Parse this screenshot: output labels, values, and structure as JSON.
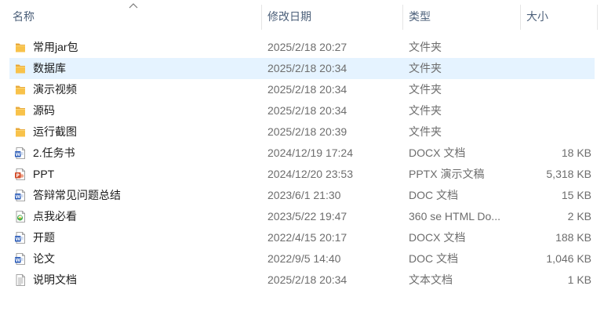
{
  "columns": {
    "name": "名称",
    "date": "修改日期",
    "type": "类型",
    "size": "大小"
  },
  "rows": [
    {
      "name": "常用jar包",
      "date": "2025/2/18 20:27",
      "type": "文件夹",
      "size": "",
      "icon": "folder-icon"
    },
    {
      "name": "数据库",
      "date": "2025/2/18 20:34",
      "type": "文件夹",
      "size": "",
      "icon": "folder-icon",
      "selected": true
    },
    {
      "name": "演示视频",
      "date": "2025/2/18 20:34",
      "type": "文件夹",
      "size": "",
      "icon": "folder-icon"
    },
    {
      "name": "源码",
      "date": "2025/2/18 20:34",
      "type": "文件夹",
      "size": "",
      "icon": "folder-icon"
    },
    {
      "name": "运行截图",
      "date": "2025/2/18 20:39",
      "type": "文件夹",
      "size": "",
      "icon": "folder-icon"
    },
    {
      "name": "2.任务书",
      "date": "2024/12/19 17:24",
      "type": "DOCX 文档",
      "size": "18 KB",
      "icon": "word-doc-icon"
    },
    {
      "name": "PPT",
      "date": "2024/12/20 23:53",
      "type": "PPTX 演示文稿",
      "size": "5,318 KB",
      "icon": "powerpoint-icon"
    },
    {
      "name": "答辩常见问题总结",
      "date": "2023/6/1 21:30",
      "type": "DOC 文档",
      "size": "15 KB",
      "icon": "word-doc-icon"
    },
    {
      "name": "点我必看",
      "date": "2023/5/22 19:47",
      "type": "360 se HTML Do...",
      "size": "2 KB",
      "icon": "html-file-icon"
    },
    {
      "name": "开题",
      "date": "2022/4/15 20:17",
      "type": "DOCX 文档",
      "size": "188 KB",
      "icon": "word-doc-icon"
    },
    {
      "name": "论文",
      "date": "2022/9/5 14:40",
      "type": "DOC 文档",
      "size": "1,046 KB",
      "icon": "word-doc-icon"
    },
    {
      "name": "说明文档",
      "date": "2025/2/18 20:34",
      "type": "文本文档",
      "size": "1 KB",
      "icon": "text-file-icon"
    }
  ],
  "colors": {
    "selected_row": "#e5f3ff",
    "header_text": "#4c607a",
    "folder": "#f8c24a",
    "word": "#2b5cb8",
    "powerpoint": "#d35230",
    "html": "#4caf50"
  }
}
